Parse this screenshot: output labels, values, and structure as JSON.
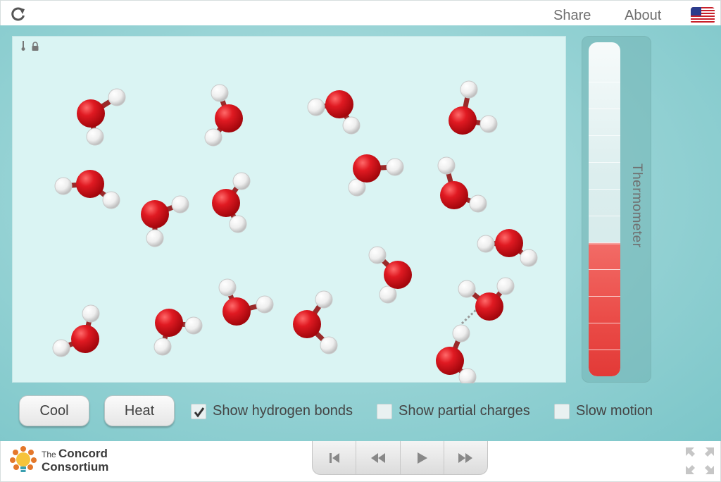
{
  "header": {
    "reload_icon": "reload-icon",
    "share_label": "Share",
    "about_label": "About",
    "language_icon": "us-flag-icon"
  },
  "simulation": {
    "corner_icons": [
      "thermometer-small-icon",
      "lock-icon"
    ],
    "colors": {
      "oxygen": "#d9131b",
      "hydrogen": "#f2f2f2",
      "background": "#daf4f3"
    },
    "hydrogen_bond_visible": true
  },
  "thermometer": {
    "label": "Thermometer",
    "level_fraction": 0.4,
    "fill_color": "#ea4a46"
  },
  "controls": {
    "cool_label": "Cool",
    "heat_label": "Heat",
    "checkboxes": [
      {
        "label": "Show hydrogen bonds",
        "checked": true
      },
      {
        "label": "Show partial charges",
        "checked": false
      },
      {
        "label": "Slow motion",
        "checked": false
      }
    ]
  },
  "footer": {
    "logo_icon": "concord-consortium-logo-icon",
    "logo_line1_small": "The",
    "logo_line1_bold": "Concord",
    "logo_line2": "Consortium",
    "playback": [
      "reset-icon",
      "rewind-icon",
      "play-icon",
      "fast-forward-icon"
    ],
    "fullscreen_icon": "fullscreen-icon"
  }
}
